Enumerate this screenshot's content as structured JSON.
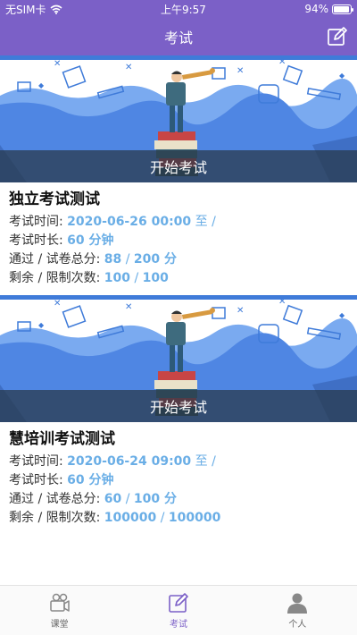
{
  "status_bar": {
    "carrier": "无SIM卡",
    "wifi_icon": "wifi-icon",
    "time": "上午9:57",
    "battery_text": "94%",
    "battery_level": 0.94
  },
  "nav": {
    "title": "考试",
    "edit_icon": "edit-icon"
  },
  "exams": [
    {
      "start_label": "开始考试",
      "title": "独立考试测试",
      "time_label": "考试时间: ",
      "time_value": "2020-06-26 00:00",
      "time_to": " 至  /",
      "duration_label": "考试时长: ",
      "duration_value": "60 分钟",
      "score_label": "通过 / 试卷总分: ",
      "pass_score": "88",
      "total_score": "200 分",
      "attempts_label": "剩余 / 限制次数: ",
      "remaining": "100",
      "limit": "100"
    },
    {
      "start_label": "开始考试",
      "title": "慧培训考试测试",
      "time_label": "考试时间: ",
      "time_value": "2020-06-24 09:00",
      "time_to": " 至  /",
      "duration_label": "考试时长: ",
      "duration_value": "60 分钟",
      "score_label": "通过 / 试卷总分: ",
      "pass_score": "60",
      "total_score": "100 分",
      "attempts_label": "剩余 / 限制次数: ",
      "remaining": "100000",
      "limit": "100000"
    }
  ],
  "tabs": [
    {
      "label": "课堂",
      "icon": "camera-icon",
      "active": false
    },
    {
      "label": "考试",
      "icon": "edit-icon",
      "active": true
    },
    {
      "label": "个人",
      "icon": "person-icon",
      "active": false
    }
  ],
  "colors": {
    "brand": "#7b60c7",
    "value_blue": "#6aaee6",
    "banner_blue": "#3f7bd9"
  }
}
